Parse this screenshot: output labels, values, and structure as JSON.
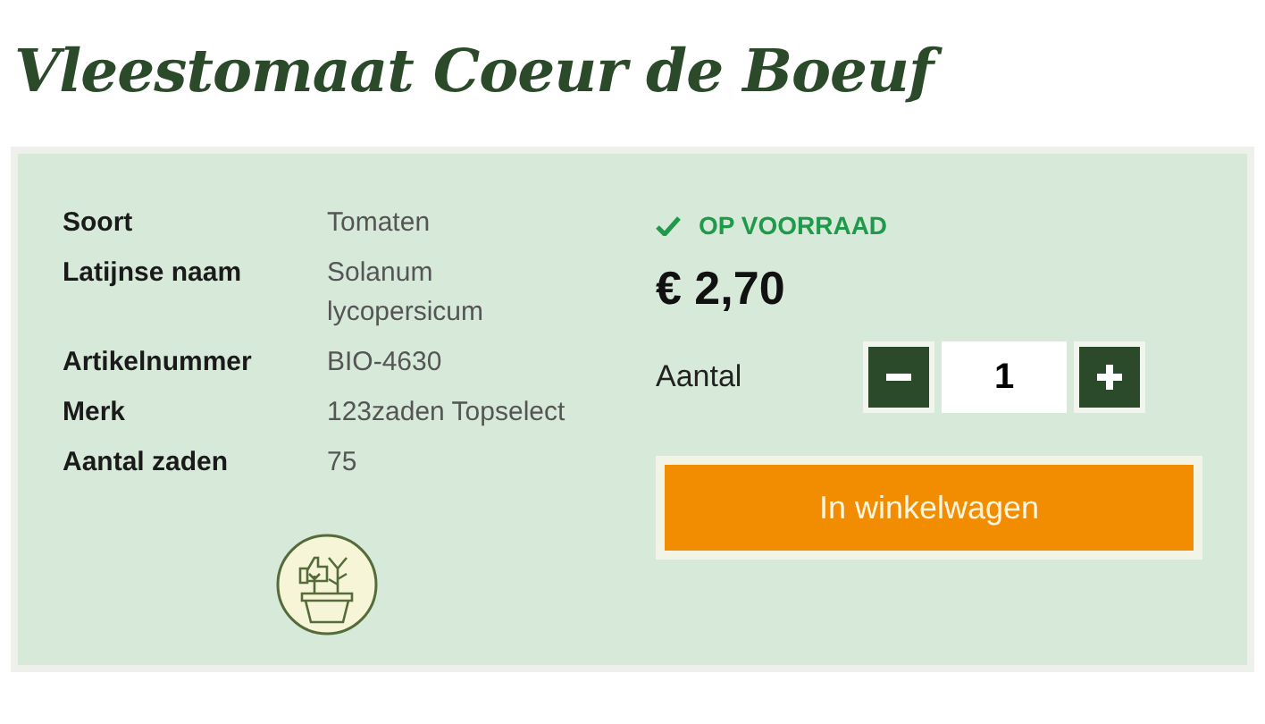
{
  "title": "Vleestomaat Coeur de Boeuf",
  "specs": [
    {
      "label": "Soort",
      "value": "Tomaten"
    },
    {
      "label": "Latijnse naam",
      "value": "Solanum lycopersicum"
    },
    {
      "label": "Artikelnummer",
      "value": "BIO-4630"
    },
    {
      "label": "Merk",
      "value": "123zaden Topselect"
    },
    {
      "label": "Aantal zaden",
      "value": "75"
    }
  ],
  "stock": {
    "in_stock": true,
    "label": "OP VOORRAAD"
  },
  "price": "€ 2,70",
  "quantity": {
    "label": "Aantal",
    "value": "1"
  },
  "cart_button": "In winkelwagen"
}
